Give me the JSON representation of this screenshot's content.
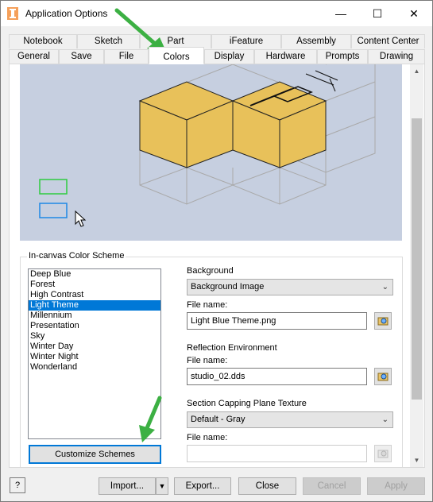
{
  "window": {
    "title": "Application Options",
    "minimize_glyph": "—",
    "maximize_glyph": "☐",
    "close_glyph": "✕"
  },
  "tabs": {
    "row1": [
      "Notebook",
      "Sketch",
      "Part",
      "iFeature",
      "Assembly",
      "Content Center"
    ],
    "row2": [
      "General",
      "Save",
      "File",
      "Colors",
      "Display",
      "Hardware",
      "Prompts",
      "Drawing"
    ],
    "active": "Colors"
  },
  "color_scheme": {
    "group_title": "In-canvas Color Scheme",
    "schemes": [
      "Deep Blue",
      "Forest",
      "High Contrast",
      "Light Theme",
      "Millennium",
      "Presentation",
      "Sky",
      "Winter Day",
      "Winter Night",
      "Wonderland"
    ],
    "selected": "Light Theme",
    "customize_label": "Customize Schemes"
  },
  "background": {
    "label": "Background",
    "value": "Background Image",
    "file_label": "File name:",
    "file_value": "Light Blue Theme.png"
  },
  "reflection": {
    "label": "Reflection Environment",
    "file_label": "File name:",
    "file_value": "studio_02.dds"
  },
  "section_capping": {
    "label": "Section Capping Plane Texture",
    "value": "Default - Gray",
    "file_label": "File name:",
    "file_value": ""
  },
  "footer": {
    "help_label": "?",
    "import_label": "Import...",
    "export_label": "Export...",
    "close_label": "Close",
    "cancel_label": "Cancel",
    "apply_label": "Apply"
  },
  "colors": {
    "selection_blue": "#0078d7",
    "preview_bg": "#c6cfe0",
    "cube_face": "#e8c15a",
    "annotation_green": "#3cb043"
  }
}
